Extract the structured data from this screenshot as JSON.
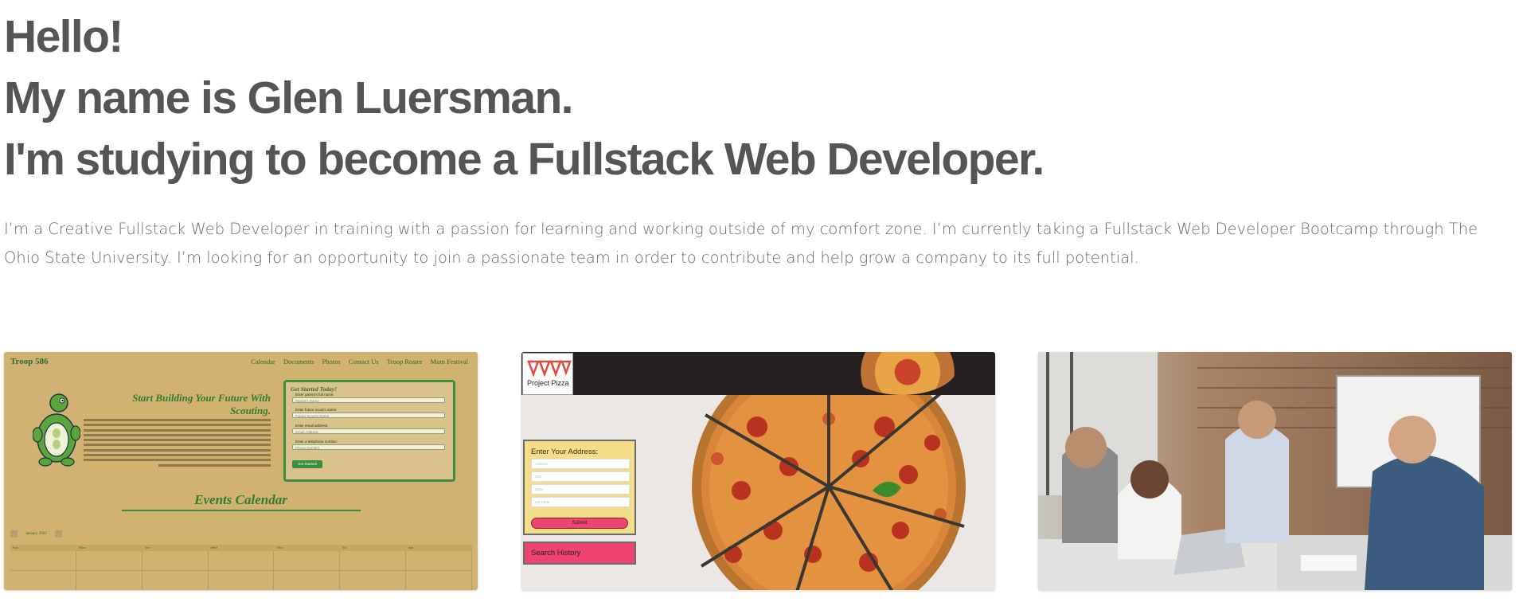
{
  "hero": {
    "line1": "Hello!",
    "line2": "My name is Glen Luersman.",
    "line3": "I'm studying to become a Fullstack Web Developer."
  },
  "intro": "I’m a Creative Fullstack Web Developer in training with a passion for learning and working outside of my comfort zone. I’m currently taking a Fullstack Web Developer Bootcamp through The Ohio State University. I’m looking for an opportunity to join a passionate team in order to contribute and help grow a company to its full potential.",
  "projects": {
    "troop": {
      "brand": "Troop 586",
      "nav": [
        "Calendar",
        "Documents",
        "Photos",
        "Contact Us",
        "Troop Roster",
        "Mum Festival"
      ],
      "heading": "Start Building Your Future With Scouting.",
      "form_title": "Get Started Today!",
      "fields": [
        {
          "label": "Enter parent's full name:",
          "placeholder": "Parent's Name"
        },
        {
          "label": "Enter future scout's name:",
          "placeholder": "Future Scout's Name"
        },
        {
          "label": "Enter email address:",
          "placeholder": "Email Address"
        },
        {
          "label": "Enter a telephone number:",
          "placeholder": "Phone Number"
        }
      ],
      "form_button": "Get Started!",
      "events_title": "Events Calendar",
      "month": "January 2022",
      "days": [
        "Sun",
        "Mon",
        "Tue",
        "Wed",
        "Thu",
        "Fri",
        "Sat"
      ]
    },
    "pizza": {
      "logo_text": "Project Pizza",
      "form_title": "Enter Your Address:",
      "placeholders": [
        "Address",
        "City",
        "State",
        "Zip Code"
      ],
      "submit": "Submit",
      "history": "Search History"
    }
  },
  "colors": {
    "heading": "#555555",
    "body_text": "#6c6c6c",
    "troop_bg": "#d2b271",
    "troop_green": "#2e7d32",
    "pizza_pink": "#f0436f",
    "pizza_yellow": "#f5dd8a"
  }
}
